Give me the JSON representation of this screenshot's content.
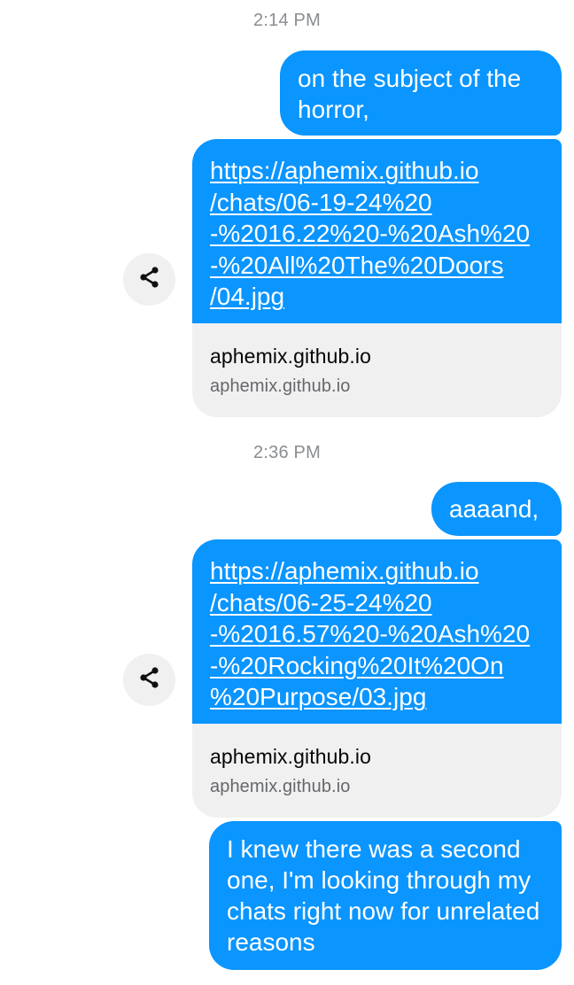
{
  "conversation": {
    "timestamps": [
      "2:14 PM",
      "2:36 PM"
    ],
    "messages": {
      "m1": "on the subject of the horror,",
      "m2": "aaaand,",
      "m3": "I knew there was a second one, I'm looking through my chats right now for unrelated reasons"
    },
    "links": [
      {
        "url_lines": [
          "https://aphemix.github.io",
          "/chats/06-19-24%20",
          "-%2016.22%20-%20Ash%20",
          "-%20All%20The%20Doors",
          "/04.jpg"
        ],
        "preview_title": "aphemix.github.io",
        "preview_domain": "aphemix.github.io"
      },
      {
        "url_lines": [
          "https://aphemix.github.io",
          "/chats/06-25-24%20",
          "-%2016.57%20-%20Ash%20",
          "-%20Rocking%20It%20On",
          "%20Purpose/03.jpg"
        ],
        "preview_title": "aphemix.github.io",
        "preview_domain": "aphemix.github.io"
      }
    ]
  },
  "colors": {
    "bubble_blue": "#0a95ff",
    "preview_gray": "#f0f0f0",
    "timestamp_gray": "#8a8d91"
  },
  "icons": {
    "share": "share-icon"
  }
}
